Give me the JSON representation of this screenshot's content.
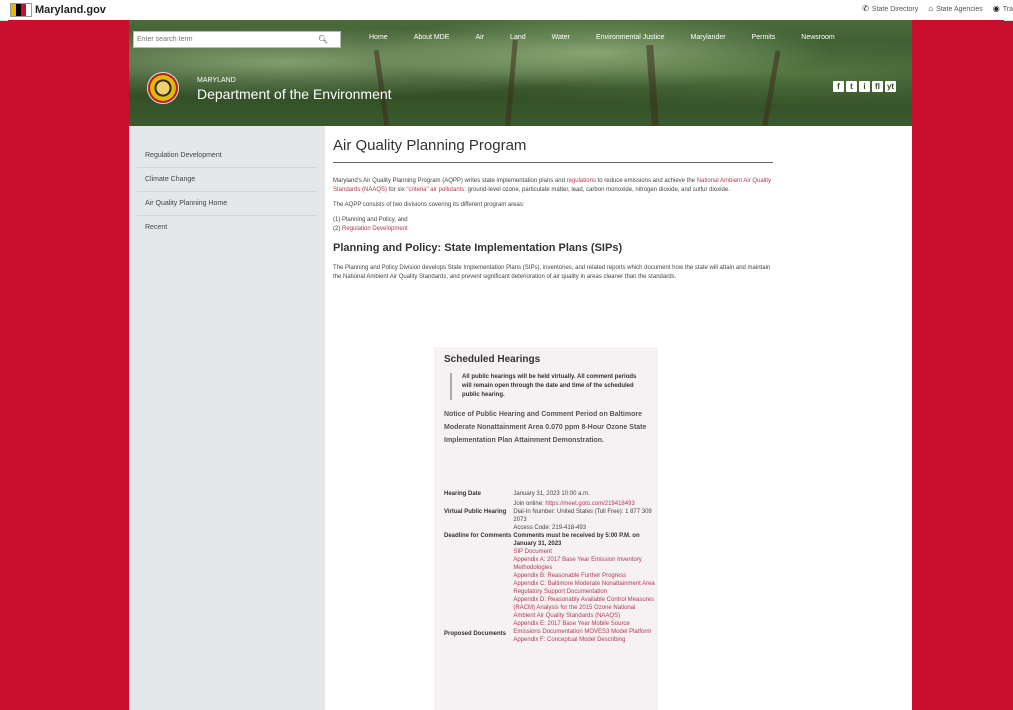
{
  "topbar": {
    "logo_text": "Maryland.gov",
    "links": [
      {
        "icon": "phone-icon",
        "glyph": "✆",
        "label": "State Directory"
      },
      {
        "icon": "building-icon",
        "glyph": "⌂",
        "label": "State Agencies"
      },
      {
        "icon": "globe-icon",
        "glyph": "◉",
        "label": "Tra"
      }
    ]
  },
  "header": {
    "search_placeholder": "Enter search term",
    "nav": [
      "Home",
      "About MDE",
      "Air",
      "Land",
      "Water",
      "Environmental Justice",
      "Marylander",
      "Permits",
      "Newsroom"
    ],
    "dept_small": "MARYLAND",
    "dept_big": "Department of the Environment",
    "social": [
      "f",
      "t",
      "i",
      "fl",
      "yt"
    ]
  },
  "sidebar": {
    "items": [
      "Regulation Development",
      "Climate Change",
      "Air Quality Planning Home",
      "Recent"
    ]
  },
  "main": {
    "title": "Air Quality Planning Program",
    "intro": {
      "p1": "Maryland's Air Quality Planning Program (AQPP) writes state implementation plans and ",
      "p1_link": "regulations",
      "p2": " to reduce emissions and achieve the ",
      "p2_link": "National Ambient Air Quality Standards (NAAQS)",
      "p3": " for six ",
      "p3_link": "\"criteria\" air pollutants",
      "p4": ": ground-level ozone, particulate matter, lead, carbon monoxide, nitrogen dioxide, and sulfur dioxide."
    },
    "divisions_intro": "The AQPP consists of two divisions covering its different program areas:",
    "division1": "(1) Planning and Policy, and",
    "division2_prefix": "(2) ",
    "division2_link": "Regulation Development",
    "section_title": "Planning and Policy: State Implementation Plans (SIPs)",
    "section_body": "The Planning and Policy Division develops State Implementation Plans (SIPs), inventories, and related reports which document how the state will attain and maintain the National Ambient Air Quality Standards, and prevent significant deterioration of air quality in areas cleaner than the standards."
  },
  "hearings": {
    "title": "Scheduled Hearings",
    "quote": "All public hearings will be held virtually. All comment periods will remain open through the date and time of the scheduled public hearing.",
    "notice": "Notice of Public Hearing and Comment Period on Baltimore Moderate Nonattainment Area 0.070 ppm 8-Hour Ozone State Implementation Plan Attainment Demonstration.",
    "hearing_date_label": "Hearing Date",
    "hearing_date": "January 31, 2023 10:00 a.m.",
    "virtual_label": "Virtual Public Hearing",
    "join_prefix": "Join online: ",
    "join_link": "https://meet.goto.com/219418493",
    "dial_in": "Dial-In Number: United States (Toll Free): 1 877 309 2073",
    "access_code": "Access Code: 219-418-493",
    "deadline_label": "Deadline for Comments",
    "deadline": "Comments must be received by 5:00 P.M. on January 31, 2023",
    "proposed_label": "Proposed Documents",
    "documents": [
      "SIP Document",
      "Appendix A: 2017 Base Year Emission Inventory Methodologies",
      "Appendix B: Reasonable Further Progress",
      "Appendix C: Baltimore Moderate Nonattainment Area Regulatory Support Documentation",
      "Appendix D: Reasonably Available Control Measures (RACM) Analysis for the 2015 Ozone National Ambient Air Quality Standards (NAAQS)",
      "Appendix E: 2017 Base Year Mobile Source Emissions Documentation MOVES3 Model Platform",
      "Appendix F: Conceptual Model Describing"
    ]
  }
}
